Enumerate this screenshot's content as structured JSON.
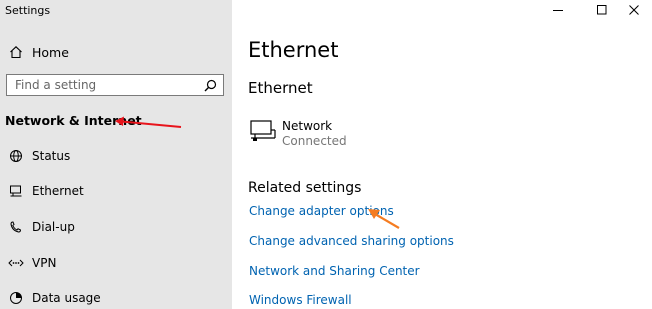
{
  "window": {
    "title": "Settings",
    "controls": [
      "minimize",
      "maximize",
      "close"
    ]
  },
  "sidebar": {
    "home_label": "Home",
    "search": {
      "placeholder": "Find a setting",
      "value": ""
    },
    "section_title": "Network & Internet",
    "items": [
      {
        "label": "Status",
        "icon": "globe-icon"
      },
      {
        "label": "Ethernet",
        "icon": "ethernet-icon"
      },
      {
        "label": "Dial-up",
        "icon": "dialup-icon"
      },
      {
        "label": "VPN",
        "icon": "vpn-icon"
      },
      {
        "label": "Data usage",
        "icon": "data-usage-icon"
      }
    ]
  },
  "main": {
    "page_title": "Ethernet",
    "subtitle": "Ethernet",
    "network": {
      "name": "Network",
      "status": "Connected",
      "icon": "network-computer-icon"
    },
    "related_title": "Related settings",
    "links": [
      "Change adapter options",
      "Change advanced sharing options",
      "Network and Sharing Center",
      "Windows Firewall"
    ]
  },
  "colors": {
    "sidebar_bg": "#e6e6e6",
    "link": "#0063b1",
    "annotation_red": "#e8141c",
    "annotation_orange": "#f57c21"
  }
}
